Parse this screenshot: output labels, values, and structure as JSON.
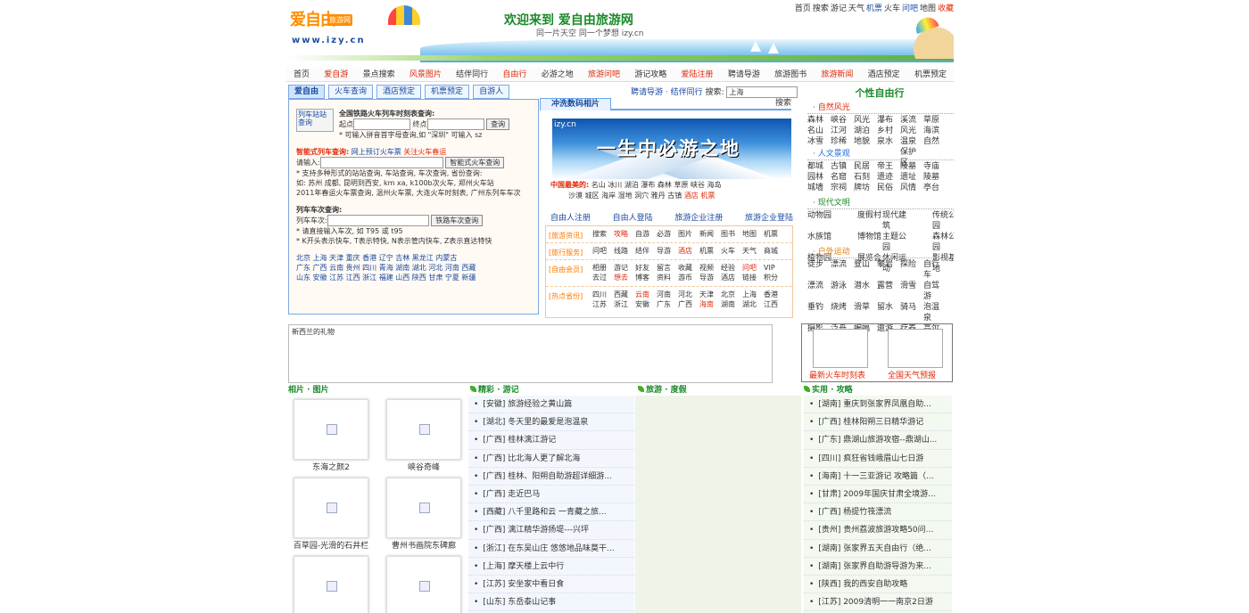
{
  "header": {
    "logo_text_1": "爱自由",
    "logo_badge": "旅游网",
    "logo_url": "www.izy.cn",
    "welcome": "欢迎来到 爱自由旅游网",
    "slogan": "同一片天空 同一个梦想 izy.cn",
    "top_links": [
      {
        "label": "首页",
        "color": "#333"
      },
      {
        "label": "搜索",
        "color": "#333"
      },
      {
        "label": "游记",
        "color": "#333"
      },
      {
        "label": "天气",
        "color": "#333"
      },
      {
        "label": "机票",
        "color": "#1a4aa0"
      },
      {
        "label": "火车",
        "color": "#333"
      },
      {
        "label": "问吧",
        "color": "#1a4aa0"
      },
      {
        "label": "地图",
        "color": "#333"
      },
      {
        "label": "收藏",
        "color": "#e02a0a"
      }
    ]
  },
  "nav": [
    {
      "label": "首页",
      "red": false
    },
    {
      "label": "爱自游",
      "red": true
    },
    {
      "label": "景点搜索",
      "red": false
    },
    {
      "label": "风景图片",
      "red": true
    },
    {
      "label": "结伴同行",
      "red": false
    },
    {
      "label": "自由行",
      "red": true
    },
    {
      "label": "必游之地",
      "red": false
    },
    {
      "label": "旅游问吧",
      "red": true
    },
    {
      "label": "游记攻略",
      "red": false
    },
    {
      "label": "爱陆注册",
      "red": true
    },
    {
      "label": "聘请导游",
      "red": false
    },
    {
      "label": "旅游图书",
      "red": false
    },
    {
      "label": "旅游新闻",
      "red": true
    },
    {
      "label": "酒店预定",
      "red": false
    },
    {
      "label": "机票预定",
      "red": false
    }
  ],
  "left_tabs": [
    "爱自由",
    "火车查询",
    "酒店预定",
    "机票预定",
    "自游人"
  ],
  "train": {
    "img_alt": "列车站站查询",
    "title": "全国铁路火车列车时刻表查询:",
    "start_label": "起点",
    "end_label": "终点",
    "query_btn": "查询",
    "hint": "* 可输入拼音首字母查询,如 \"深圳\" 可输入 sz",
    "smart_title": "智能式列车查询:",
    "smart_link1": "网上预订火车票",
    "smart_link2": "关注火车春运",
    "input_label": "请输入:",
    "smart_btn": "智能式火车查询",
    "smart_desc_1": "* 支持多种形式的站站查询, 车站查询, 车次查询, 省份查询:",
    "smart_desc_2": "如: 苏州 成都, 昆明到西安, km xa, k100b次火车, 郑州火车站",
    "smart_desc_3": "2011年春运火车票查询, 温州火车票, 大连火车时刻表, 广州东列车车次",
    "no_title": "列车车次查询:",
    "no_label": "列车车次:",
    "no_btn": "铁路车次查询",
    "no_hint_1": "* 请直接输入车次, 如 T95 或 t95",
    "no_hint_2": "* K开头表示快车, T表示特快, N表示管内快车, Z表示直达特快",
    "cities_1": "北京 上海 天津 重庆 香港 辽宁 吉林 黑龙江 内蒙古",
    "cities_2": "广东 广西 云南 贵州 四川 青海 湖南 湖北 河北 河南 西藏",
    "cities_3": "山东 安徽 江苏 江西 浙江 福建 山西 陕西 甘肃 宁夏 新疆"
  },
  "mid": {
    "head_links": "聘请导游 · 结伴同行",
    "search_label": "搜索:",
    "search_value": "上海",
    "search_btn": "搜索",
    "photo_tab": "冲洗数码相片",
    "banner_site": "izy.cn",
    "banner_text": "一生中必游之地",
    "scenic_label": "中国最美的:",
    "scenic_1": "名山 冰川 湖泊 瀑布 森林 草原 峡谷 海岛",
    "scenic_2": "沙漠 城区 海岸 湿地 洞穴 雅丹 古镇",
    "scenic_hotel": "酒店",
    "scenic_ticket": "机票",
    "member_links": [
      "自由人注册",
      "自由人登陆",
      "旅游企业注册",
      "旅游企业登陆"
    ],
    "services": [
      {
        "label": "[旅游资讯]",
        "rows": [
          [
            {
              "t": "搜索"
            },
            {
              "t": "攻略",
              "c": "#e02a0a"
            },
            {
              "t": "自游"
            },
            {
              "t": "必游"
            },
            {
              "t": "图片"
            },
            {
              "t": "新闻"
            },
            {
              "t": "图书"
            },
            {
              "t": "地图"
            },
            {
              "t": "机票"
            }
          ]
        ]
      },
      {
        "label": "[旅行服务]",
        "rows": [
          [
            {
              "t": "问吧"
            },
            {
              "t": "线路"
            },
            {
              "t": "结伴"
            },
            {
              "t": "导游"
            },
            {
              "t": "酒店",
              "c": "#e02a0a"
            },
            {
              "t": "机票"
            },
            {
              "t": "火车"
            },
            {
              "t": "天气"
            },
            {
              "t": "商城"
            }
          ]
        ]
      },
      {
        "label": "[自由会员]",
        "rows": [
          [
            {
              "t": "相册"
            },
            {
              "t": "游记"
            },
            {
              "t": "好友"
            },
            {
              "t": "留言"
            },
            {
              "t": "收藏"
            },
            {
              "t": "视频"
            },
            {
              "t": "经验"
            },
            {
              "t": "问吧",
              "c": "#e02a0a"
            },
            {
              "t": "VIP"
            }
          ],
          [
            {
              "t": "去过"
            },
            {
              "t": "想去",
              "c": "#e02a0a"
            },
            {
              "t": "博客"
            },
            {
              "t": "资料"
            },
            {
              "t": "游币"
            },
            {
              "t": "导游"
            },
            {
              "t": "酒店"
            },
            {
              "t": "链接"
            },
            {
              "t": "积分"
            }
          ]
        ]
      },
      {
        "label": "[热点省份]",
        "rows": [
          [
            {
              "t": "四川"
            },
            {
              "t": "西藏"
            },
            {
              "t": "云南",
              "c": "#e02a0a"
            },
            {
              "t": "河南"
            },
            {
              "t": "河北"
            },
            {
              "t": "天津"
            },
            {
              "t": "北京"
            },
            {
              "t": "上海"
            },
            {
              "t": "香港"
            }
          ],
          [
            {
              "t": "江苏"
            },
            {
              "t": "浙江"
            },
            {
              "t": "安徽"
            },
            {
              "t": "广东"
            },
            {
              "t": "广西"
            },
            {
              "t": "海南",
              "c": "#e02a0a"
            },
            {
              "t": "湖南"
            },
            {
              "t": "湖北"
            },
            {
              "t": "江西"
            }
          ]
        ]
      }
    ]
  },
  "right": {
    "title": "个性自由行",
    "sections": [
      {
        "head": "· 自然风光",
        "color": "#e02a0a",
        "items": [
          "森林",
          "峡谷",
          "风光",
          "瀑布",
          "溪流",
          "草原",
          "名山",
          "江河",
          "湖泊",
          "乡村",
          "风光",
          "海滨",
          "冰雪",
          "珍稀",
          "地貌",
          "泉水",
          "温泉",
          "自然",
          "",
          "",
          "",
          "",
          "保护区",
          ""
        ]
      },
      {
        "head": "· 人文景观",
        "color": "#1a6bd6",
        "items": [
          "都城",
          "古镇",
          "民居",
          "帝王",
          "陵墓",
          "寺庙",
          "园林",
          "名窟",
          "石刻",
          "遗迹",
          "遗址",
          "陵墓",
          "城墙",
          "宗祠",
          "牌坊",
          "民俗",
          "风情",
          "亭台"
        ]
      },
      {
        "head": "· 现代文明",
        "color": "#1a8a2a",
        "items": [
          "动物园",
          "",
          "度假村",
          "现代建筑",
          "",
          "传统公园",
          "水族馆",
          "",
          "博物馆",
          "主题公园",
          "",
          "森林公园",
          "植物园",
          "",
          "展览会",
          "休闲运动",
          "",
          "影视基地"
        ]
      },
      {
        "head": "· 户外运动",
        "color": "#e67a00",
        "items": [
          "徒步",
          "漂流",
          "登山",
          "攀岩",
          "探险",
          "自行车",
          "漂流",
          "游泳",
          "潜水",
          "露营",
          "滑雪",
          "自驾游",
          "垂钓",
          "烧烤",
          "滑草",
          "留水",
          "骑马",
          "泡温泉",
          "摄影",
          "泛舟",
          "蝙蝠",
          "遨游",
          "疗养",
          "高尔夫"
        ]
      }
    ],
    "box_caps": [
      "最新火车时刻表",
      "全国天气预报"
    ]
  },
  "ad": {
    "alt": "新西兰的礼物"
  },
  "bottom": {
    "gallery_head": "相片 · 图片",
    "gallery": [
      "东海之颜2",
      "峡谷奇峰",
      "百草园-光滑的石井栏",
      "曹州书画院东碑廊",
      "",
      ""
    ],
    "col2_head": "精彩 · 游记",
    "col2": [
      "[安徽] 旅游经验之黄山篇",
      "[湖北] 冬天里的最爱是泡温泉",
      "[广西] 桂林漓江游记",
      "[广西] 比北海人更了解北海",
      "[广西] 桂林、阳朔自助游超详细游...",
      "[广西] 走近巴马",
      "[西藏] 八千里路和云 一青藏之旅...",
      "[广西] 漓江精华游扬堤---兴坪",
      "[浙江] 在东吴山庄 悠悠地品味莫干...",
      "[上海] 摩天楼上云中行",
      "[江苏] 安坐家中看日食",
      "[山东] 东岳泰山记事"
    ],
    "col3_head": "旅游 · 度假",
    "col4_head": "实用 · 攻略",
    "col4": [
      "[湖南] 重庆到张家界凤凰自助...",
      "[广西] 桂林阳朔三日精华游记",
      "[广东] 鼎湖山旅游攻宿--鼎湖山...",
      "[四川] 疯狂省钱峨眉山七日游",
      "[海南] 十一三亚游记 攻略篇（...",
      "[甘肃] 2009年国庆甘肃全境游...",
      "[广西] 杨提竹筏漂流",
      "[贵州] 贵州荔波旅游攻略50问...",
      "[湖南] 张家界五天自由行（绝...",
      "[湖南] 张家界自助游导游为来...",
      "[陕西] 我的西安自助攻略",
      "[江苏] 2009清明一一南京2日游"
    ]
  }
}
